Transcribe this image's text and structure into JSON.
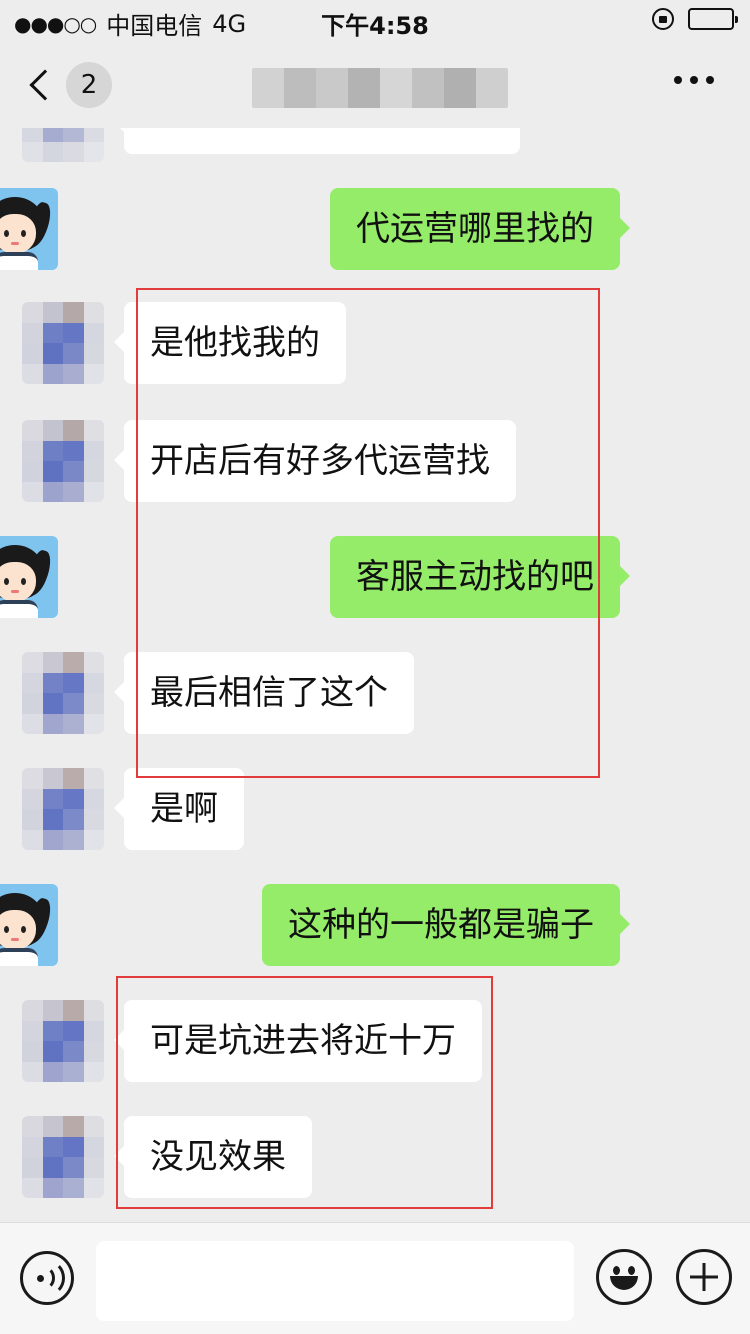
{
  "status_bar": {
    "signal": "●●●○○",
    "carrier": "中国电信",
    "network": "4G",
    "time": "下午4:58"
  },
  "nav": {
    "back_count": "2",
    "title_blurred": true,
    "more_icon": "more-icon"
  },
  "messages": [
    {
      "side": "in",
      "text": "是他找我的"
    },
    {
      "side": "in",
      "text": "开店后有好多代运营找"
    },
    {
      "side": "out",
      "text": "客服主动找的吧"
    },
    {
      "side": "in",
      "text": "最后相信了这个"
    },
    {
      "side": "in",
      "text": "是啊"
    },
    {
      "side": "out",
      "text": "这种的一般都是骗子"
    },
    {
      "side": "in",
      "text": "可是坑进去将近十万"
    },
    {
      "side": "in",
      "text": "没见效果"
    }
  ],
  "top_message": {
    "side": "out",
    "text": "代运营哪里找的"
  },
  "input": {
    "value": "",
    "placeholder": ""
  },
  "colors": {
    "outgoing_bubble": "#95ec69",
    "incoming_bubble": "#ffffff",
    "background": "#ededed",
    "highlight": "#e23b3b"
  }
}
